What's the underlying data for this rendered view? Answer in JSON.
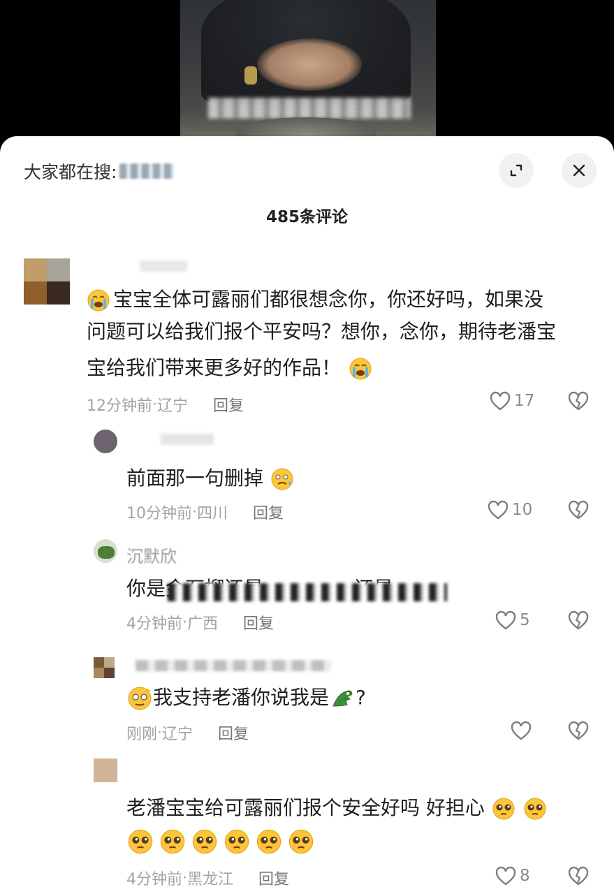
{
  "search": {
    "prefix": "大家都在搜:",
    "query_hidden": true
  },
  "header": {
    "comment_count": "485条评论"
  },
  "icons": {
    "expand": "expand-icon",
    "close": "close-icon",
    "like": "heart-outline-icon",
    "dislike": "broken-heart-icon",
    "crying": "loudly-crying-face-emoji",
    "sweat": "anxious-sweat-face-emoji",
    "dizzy": "dizzy-face-emoji",
    "crocodile": "crocodile-emoji",
    "pleading": "pleading-face-emoji"
  },
  "comments": [
    {
      "text_line1": "宝宝全体可露丽们都很想念你，你还好吗，如果没",
      "text_line2": "问题可以给我们报个平安吗？想你，念你，期待老潘宝",
      "text_line3": "宝给我们带来更多好的作品！",
      "time": "12分钟前",
      "location": "辽宁",
      "reply": "回复",
      "likes": "17"
    },
    {
      "text": "前面那一句删掉",
      "time": "10分钟前",
      "location": "四川",
      "reply": "回复",
      "likes": "10"
    },
    {
      "name": "沉默欣",
      "text": "你是金石榴还是",
      "text_tail": "还是",
      "time": "4分钟前",
      "location": "广西",
      "reply": "回复",
      "likes": "5"
    },
    {
      "text_pre": "我支持老潘你说我是",
      "text_post": "?",
      "time": "刚刚",
      "location": "辽宁",
      "reply": "回复",
      "likes": ""
    },
    {
      "text_line1": "老潘宝宝给可露丽们报个安全好吗 好担心",
      "time": "4分钟前",
      "location": "黑龙江",
      "reply": "回复",
      "likes": "8"
    }
  ]
}
